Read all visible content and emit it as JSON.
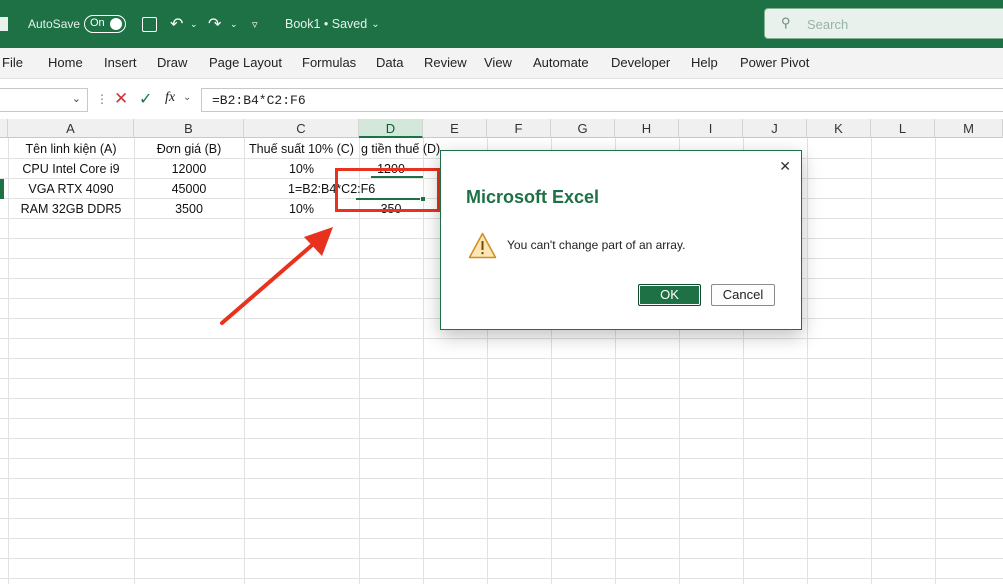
{
  "title_bar": {
    "autosave_label": "AutoSave",
    "autosave_toggle": "On",
    "doc_title": "Book1 • Saved",
    "search_placeholder": "Search"
  },
  "ribbon": {
    "tabs": [
      "File",
      "Home",
      "Insert",
      "Draw",
      "Page Layout",
      "Formulas",
      "Data",
      "Review",
      "View",
      "Automate",
      "Developer",
      "Help",
      "Power Pivot"
    ]
  },
  "formula_bar": {
    "fx": "fx",
    "formula": "=B2:B4*C2:F6"
  },
  "sheet": {
    "columns": [
      "A",
      "B",
      "C",
      "D",
      "E",
      "F",
      "G",
      "H",
      "I",
      "J",
      "K",
      "L",
      "M"
    ],
    "headers": [
      "Tên linh kiện (A)",
      "Đơn giá (B)",
      "Thuế suất 10% (C)",
      "g tiền thuế (D)"
    ],
    "rows": [
      {
        "a": "CPU Intel Core i9",
        "b": "12000",
        "c": "10%",
        "d": "1200"
      },
      {
        "a": "VGA RTX 4090",
        "b": "45000",
        "c": "1=B2:B4*C2:F6",
        "d": ""
      },
      {
        "a": "RAM 32GB DDR5",
        "b": "3500",
        "c": "10%",
        "d": "350"
      }
    ]
  },
  "dialog": {
    "title": "Microsoft Excel",
    "message": "You can't change part of an array.",
    "ok": "OK",
    "cancel": "Cancel",
    "close": "✕"
  },
  "colors": {
    "excel_green": "#1e7145",
    "annotation_red": "#e8321e"
  }
}
